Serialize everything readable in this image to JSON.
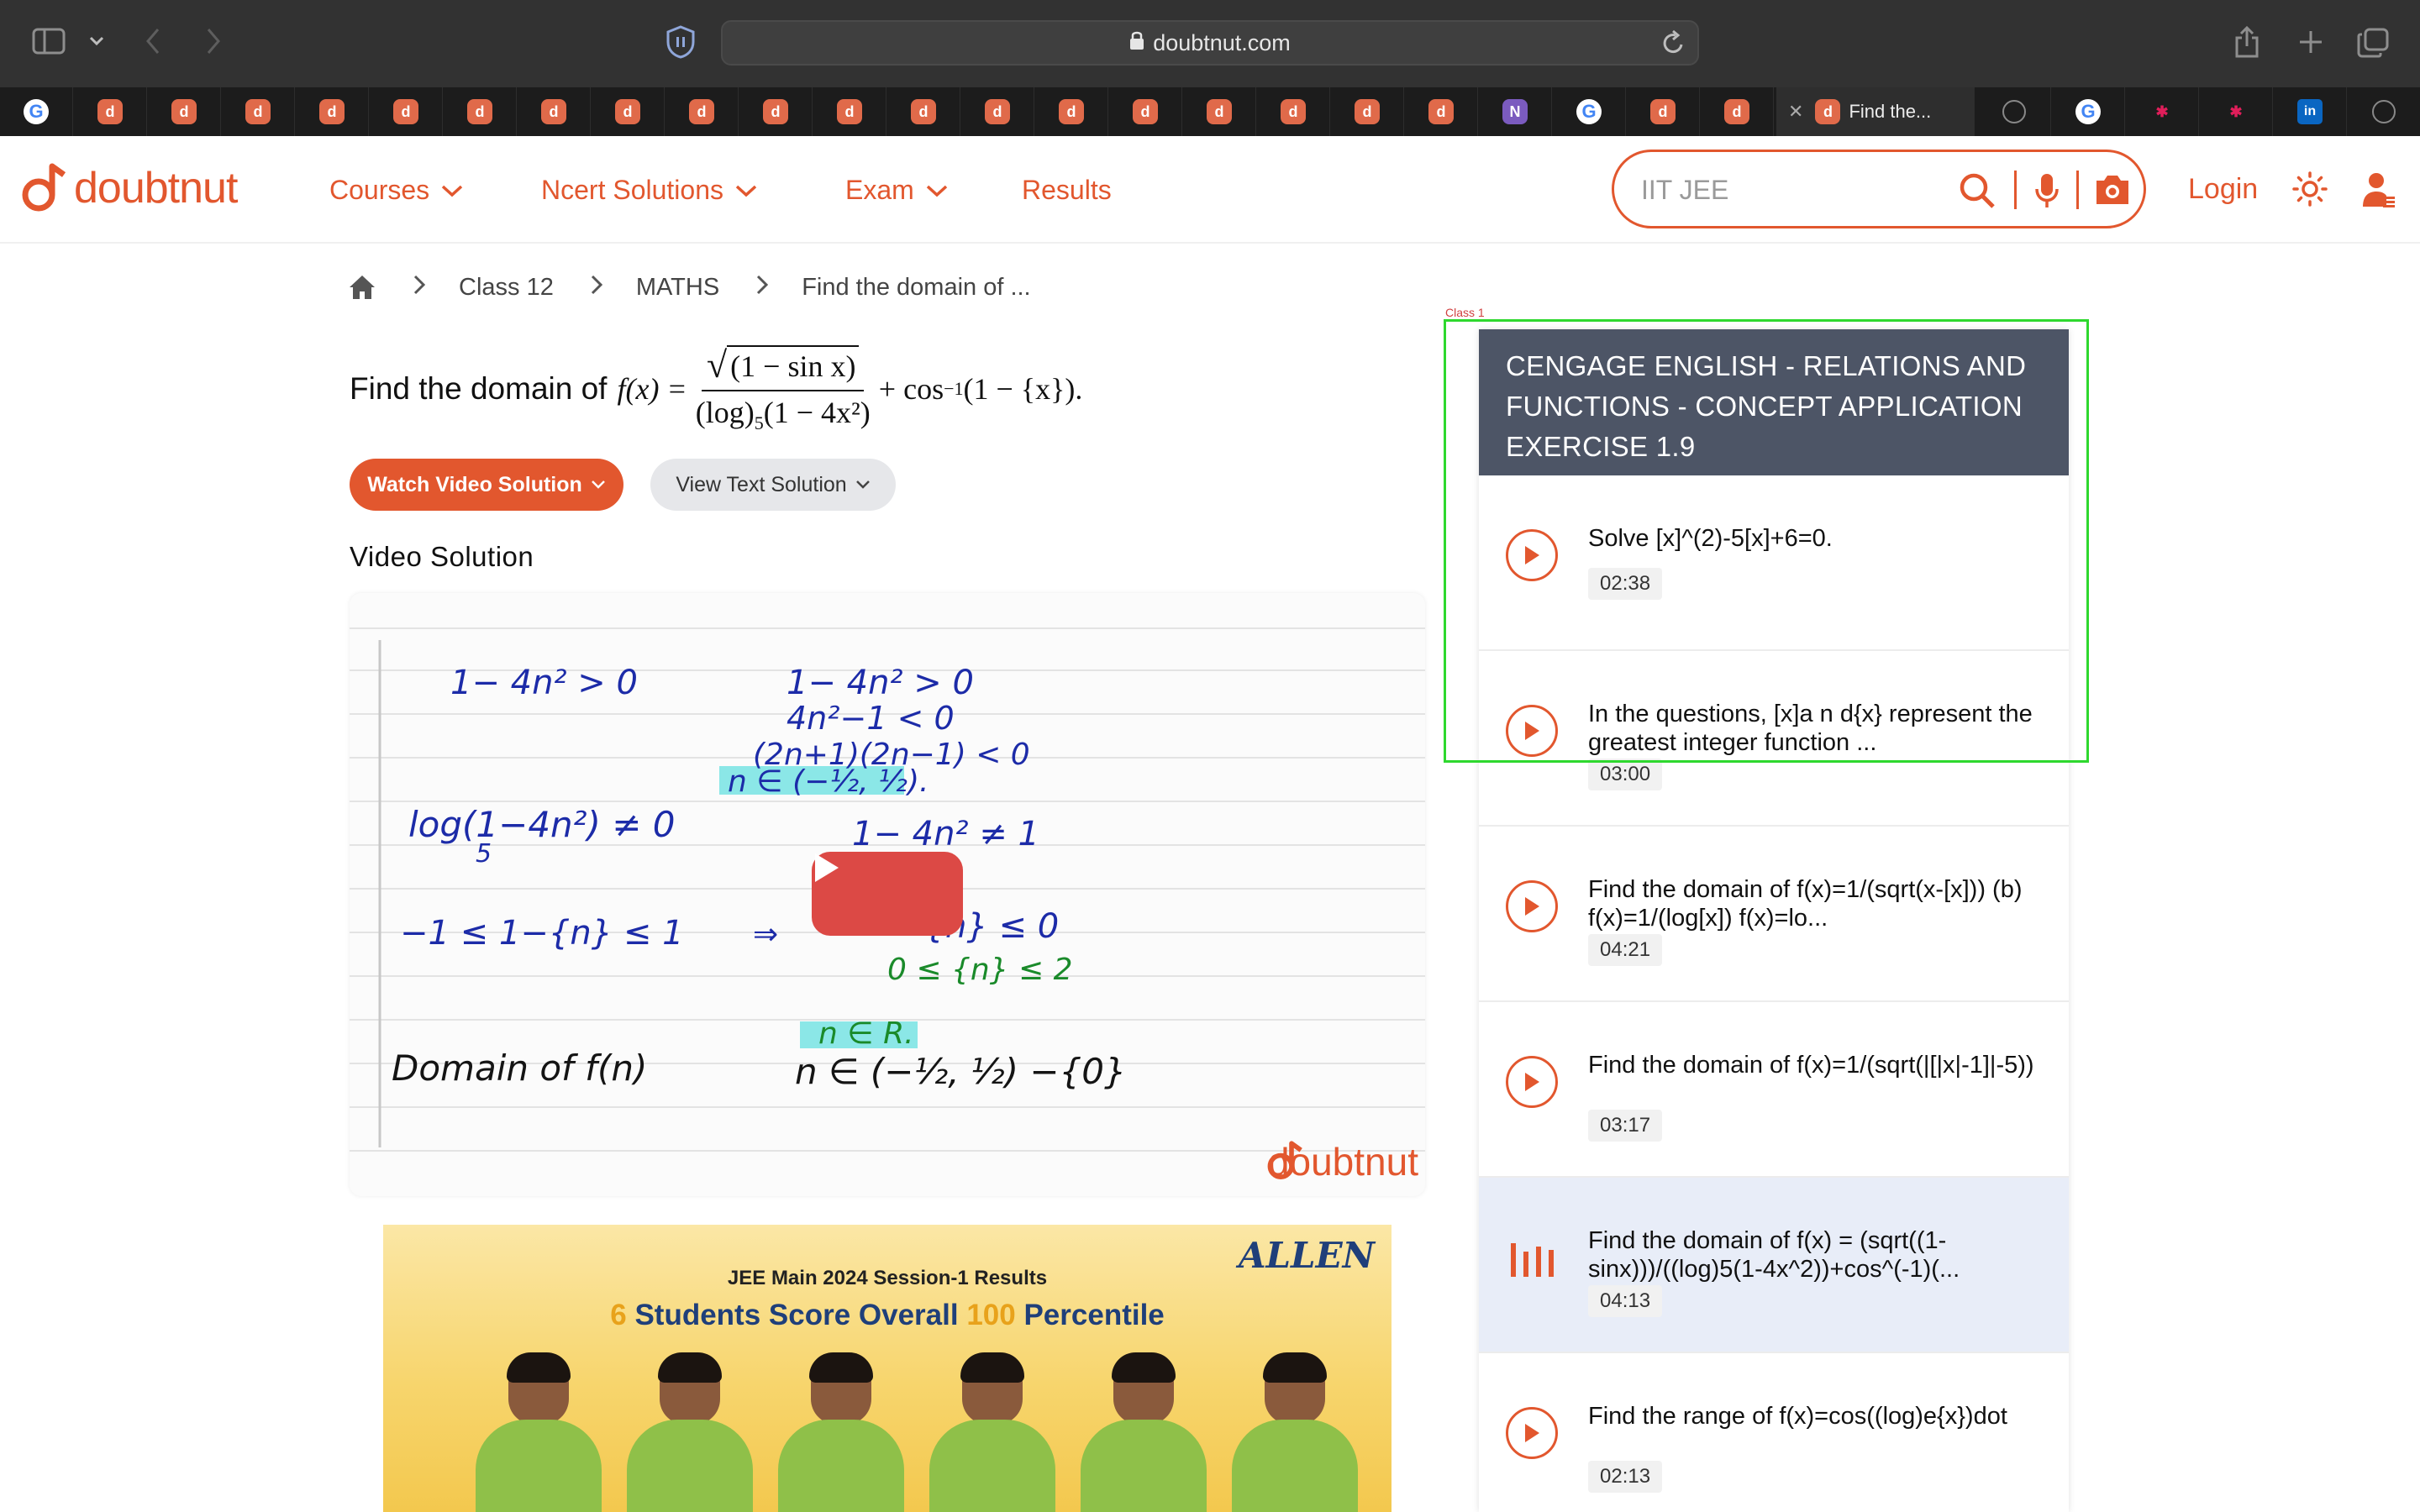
{
  "browser": {
    "url": "doubtnut.com",
    "active_tab_title": "Find the...",
    "tab_icons": [
      "google-icon",
      "doubtnut-icon",
      "doubtnut-icon",
      "doubtnut-icon",
      "doubtnut-icon",
      "doubtnut-icon",
      "doubtnut-icon",
      "doubtnut-icon",
      "doubtnut-icon",
      "doubtnut-icon",
      "doubtnut-icon",
      "doubtnut-icon",
      "doubtnut-icon",
      "doubtnut-icon",
      "doubtnut-icon",
      "doubtnut-icon",
      "doubtnut-icon",
      "doubtnut-icon",
      "doubtnut-icon",
      "doubtnut-icon",
      "onenote-icon",
      "google-icon",
      "doubtnut-icon",
      "doubtnut-icon"
    ],
    "right_tab_icons": [
      "compass-icon",
      "google-icon",
      "slack-icon",
      "slack-icon",
      "linkedin-icon",
      "chrome-icon"
    ]
  },
  "site": {
    "logo": "doubtnut",
    "nav": [
      {
        "label": "Courses"
      },
      {
        "label": "Ncert Solutions"
      },
      {
        "label": "Exam"
      },
      {
        "label": "Results"
      }
    ],
    "search_placeholder": "IIT JEE",
    "login": "Login",
    "accent": "#e2572e"
  },
  "breadcrumb": [
    "Class 12",
    "MATHS",
    "Find the domain of ..."
  ],
  "question": {
    "prefix": "Find the domain of",
    "fx": "f(x) =",
    "numerator": "(1 − sin x)",
    "denominator_log": "(log)",
    "denominator_base": "5",
    "denominator_rest": "(1 − 4x²)",
    "tail": "+ cos",
    "tail_sup": "−1",
    "tail_rest": "(1 − {x}).",
    "watch_button": "Watch Video Solution",
    "text_button": "View Text Solution"
  },
  "video": {
    "section_title": "Video Solution",
    "watermark": "doubtnut"
  },
  "ad": {
    "brand": "ALLEN",
    "headline": "JEE Main 2024 Session-1 Results",
    "sub_num1": "6",
    "sub_text1": "Students Score Overall",
    "sub_num2": "100",
    "sub_text2": "Percentile"
  },
  "panel": {
    "header": "CENGAGE ENGLISH - RELATIONS AND FUNCTIONS - CONCEPT APPLICATION EXERCISE 1.9",
    "items": [
      {
        "title": "Solve [x]^(2)-5[x]+6=0.",
        "duration": "02:38"
      },
      {
        "title": "In the questions, [x]a n d{x} represent the greatest integer function ...",
        "duration": "03:00"
      },
      {
        "title": "Find the domain of f(x)=1/(sqrt(x-[x])) (b) f(x)=1/(log[x]) f(x)=lo...",
        "duration": "04:21"
      },
      {
        "title": "Find the domain of f(x)=1/(sqrt(|[|x|-1]|-5))",
        "duration": "03:17"
      },
      {
        "title": "Find the domain of f(x) = (sqrt((1-sinx)))/((log)5(1-4x^2))+cos^(-1)(...",
        "duration": "04:13"
      },
      {
        "title": "Find the range of f(x)=cos((log)e{x})dot",
        "duration": "02:13"
      }
    ]
  },
  "annotation": {
    "label": "Class 1",
    "color": "#2ed82e"
  }
}
